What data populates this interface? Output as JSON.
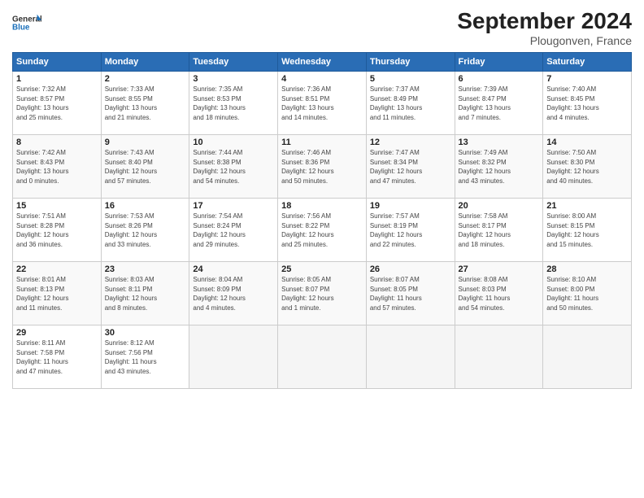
{
  "logo": {
    "general": "General",
    "blue": "Blue"
  },
  "title": "September 2024",
  "subtitle": "Plougonven, France",
  "weekdays": [
    "Sunday",
    "Monday",
    "Tuesday",
    "Wednesday",
    "Thursday",
    "Friday",
    "Saturday"
  ],
  "weeks": [
    [
      {
        "day": "1",
        "sunrise": "7:32 AM",
        "sunset": "8:57 PM",
        "daylight": "13 hours and 25 minutes."
      },
      {
        "day": "2",
        "sunrise": "7:33 AM",
        "sunset": "8:55 PM",
        "daylight": "13 hours and 21 minutes."
      },
      {
        "day": "3",
        "sunrise": "7:35 AM",
        "sunset": "8:53 PM",
        "daylight": "13 hours and 18 minutes."
      },
      {
        "day": "4",
        "sunrise": "7:36 AM",
        "sunset": "8:51 PM",
        "daylight": "13 hours and 14 minutes."
      },
      {
        "day": "5",
        "sunrise": "7:37 AM",
        "sunset": "8:49 PM",
        "daylight": "13 hours and 11 minutes."
      },
      {
        "day": "6",
        "sunrise": "7:39 AM",
        "sunset": "8:47 PM",
        "daylight": "13 hours and 7 minutes."
      },
      {
        "day": "7",
        "sunrise": "7:40 AM",
        "sunset": "8:45 PM",
        "daylight": "13 hours and 4 minutes."
      }
    ],
    [
      {
        "day": "8",
        "sunrise": "7:42 AM",
        "sunset": "8:43 PM",
        "daylight": "13 hours and 0 minutes."
      },
      {
        "day": "9",
        "sunrise": "7:43 AM",
        "sunset": "8:40 PM",
        "daylight": "12 hours and 57 minutes."
      },
      {
        "day": "10",
        "sunrise": "7:44 AM",
        "sunset": "8:38 PM",
        "daylight": "12 hours and 54 minutes."
      },
      {
        "day": "11",
        "sunrise": "7:46 AM",
        "sunset": "8:36 PM",
        "daylight": "12 hours and 50 minutes."
      },
      {
        "day": "12",
        "sunrise": "7:47 AM",
        "sunset": "8:34 PM",
        "daylight": "12 hours and 47 minutes."
      },
      {
        "day": "13",
        "sunrise": "7:49 AM",
        "sunset": "8:32 PM",
        "daylight": "12 hours and 43 minutes."
      },
      {
        "day": "14",
        "sunrise": "7:50 AM",
        "sunset": "8:30 PM",
        "daylight": "12 hours and 40 minutes."
      }
    ],
    [
      {
        "day": "15",
        "sunrise": "7:51 AM",
        "sunset": "8:28 PM",
        "daylight": "12 hours and 36 minutes."
      },
      {
        "day": "16",
        "sunrise": "7:53 AM",
        "sunset": "8:26 PM",
        "daylight": "12 hours and 33 minutes."
      },
      {
        "day": "17",
        "sunrise": "7:54 AM",
        "sunset": "8:24 PM",
        "daylight": "12 hours and 29 minutes."
      },
      {
        "day": "18",
        "sunrise": "7:56 AM",
        "sunset": "8:22 PM",
        "daylight": "12 hours and 25 minutes."
      },
      {
        "day": "19",
        "sunrise": "7:57 AM",
        "sunset": "8:19 PM",
        "daylight": "12 hours and 22 minutes."
      },
      {
        "day": "20",
        "sunrise": "7:58 AM",
        "sunset": "8:17 PM",
        "daylight": "12 hours and 18 minutes."
      },
      {
        "day": "21",
        "sunrise": "8:00 AM",
        "sunset": "8:15 PM",
        "daylight": "12 hours and 15 minutes."
      }
    ],
    [
      {
        "day": "22",
        "sunrise": "8:01 AM",
        "sunset": "8:13 PM",
        "daylight": "12 hours and 11 minutes."
      },
      {
        "day": "23",
        "sunrise": "8:03 AM",
        "sunset": "8:11 PM",
        "daylight": "12 hours and 8 minutes."
      },
      {
        "day": "24",
        "sunrise": "8:04 AM",
        "sunset": "8:09 PM",
        "daylight": "12 hours and 4 minutes."
      },
      {
        "day": "25",
        "sunrise": "8:05 AM",
        "sunset": "8:07 PM",
        "daylight": "12 hours and 1 minute."
      },
      {
        "day": "26",
        "sunrise": "8:07 AM",
        "sunset": "8:05 PM",
        "daylight": "11 hours and 57 minutes."
      },
      {
        "day": "27",
        "sunrise": "8:08 AM",
        "sunset": "8:03 PM",
        "daylight": "11 hours and 54 minutes."
      },
      {
        "day": "28",
        "sunrise": "8:10 AM",
        "sunset": "8:00 PM",
        "daylight": "11 hours and 50 minutes."
      }
    ],
    [
      {
        "day": "29",
        "sunrise": "8:11 AM",
        "sunset": "7:58 PM",
        "daylight": "11 hours and 47 minutes."
      },
      {
        "day": "30",
        "sunrise": "8:12 AM",
        "sunset": "7:56 PM",
        "daylight": "11 hours and 43 minutes."
      },
      null,
      null,
      null,
      null,
      null
    ]
  ]
}
